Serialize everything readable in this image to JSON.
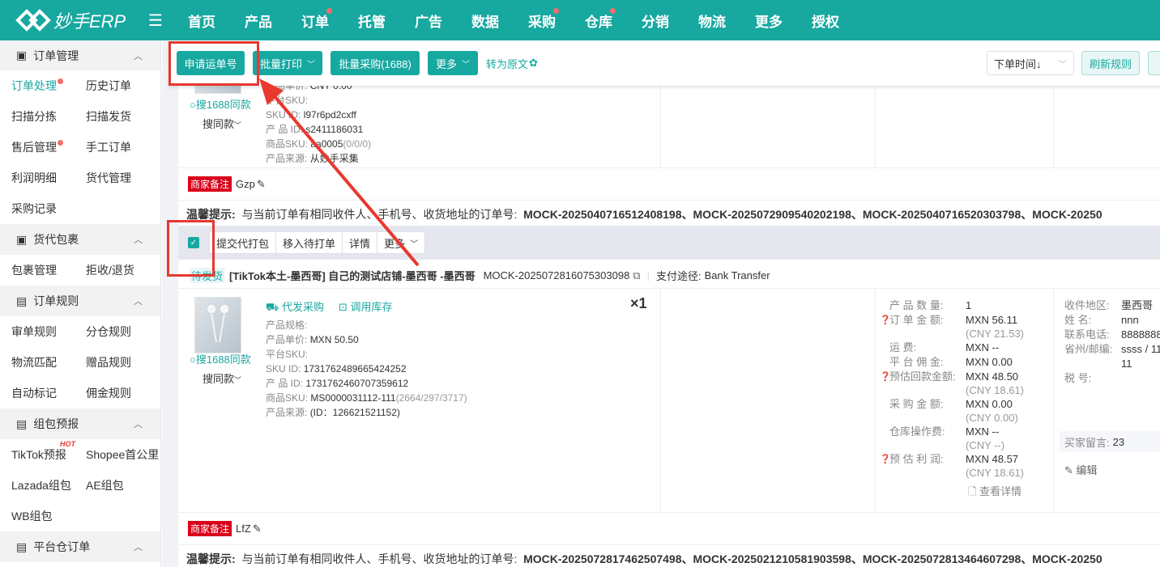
{
  "app": {
    "logo_text": "妙手ERP"
  },
  "nav": [
    {
      "label": "首页",
      "dot": false
    },
    {
      "label": "产品",
      "dot": false
    },
    {
      "label": "订单",
      "dot": true
    },
    {
      "label": "托管",
      "dot": false
    },
    {
      "label": "广告",
      "dot": false
    },
    {
      "label": "数据",
      "dot": false
    },
    {
      "label": "采购",
      "dot": true
    },
    {
      "label": "仓库",
      "dot": true
    },
    {
      "label": "分销",
      "dot": false
    },
    {
      "label": "物流",
      "dot": false
    },
    {
      "label": "更多",
      "dot": false
    },
    {
      "label": "授权",
      "dot": false
    }
  ],
  "sidebar": {
    "sections": [
      {
        "title": "订单管理",
        "items": [
          "订单处理",
          "历史订单",
          "扫描分拣",
          "扫描发货",
          "售后管理",
          "手工订单",
          "利润明细",
          "货代管理",
          "采购记录"
        ]
      },
      {
        "title": "货代包裹",
        "items": [
          "包裹管理",
          "拒收/退货"
        ]
      },
      {
        "title": "订单规则",
        "items": [
          "审单规则",
          "分仓规则",
          "物流匹配",
          "赠品规则",
          "自动标记",
          "佣金规则"
        ]
      },
      {
        "title": "组包预报",
        "items": [
          "TikTok预报",
          "Shopee首公里",
          "Lazada组包",
          "AE组包",
          "WB组包"
        ]
      },
      {
        "title": "平台仓订单",
        "items": []
      }
    ],
    "hot_label": "HOT"
  },
  "toolbar": {
    "apply_waybill": "申请运单号",
    "batch_print": "批量打印",
    "batch_purchase": "批量采购(1688)",
    "more": "更多",
    "to_original": "转为原文",
    "sort_select": "下单时间↓",
    "refresh_rules": "刷新规则"
  },
  "order1": {
    "partial_price": "CNY 0.00",
    "platform_sku_label": "平台SKU:",
    "sku_id_label": "SKU   ID:",
    "sku_id": "l97r6pd2cxff",
    "product_id_label": "产 品 ID:",
    "product_id": "s2411186031",
    "goods_sku_label": "商品SKU:",
    "goods_sku": "aa0005",
    "goods_sku_stock": "(0/0/0)",
    "source_label": "产品来源:",
    "source": "从妙手采集",
    "search1688": "搜1688同款",
    "search_same": "搜同款",
    "merchant_note_tag": "商家备注",
    "merchant_note": "Gzp",
    "tip_label": "温馨提示:",
    "tip_text": "与当前订单有相同收件人、手机号、收货地址的订单号:",
    "tip_orders": "MOCK-2025040716512408198、MOCK-2025072909540202198、MOCK-2025040716520303798、MOCK-20250"
  },
  "actions": {
    "submit_pack": "提交代打包",
    "move_pending": "移入待打单",
    "detail": "详情",
    "more": "更多"
  },
  "order2": {
    "status": "待发货",
    "shop": "[TikTok本土-墨西哥]  自己的测试店铺-墨西哥 -墨西哥",
    "order_no": "MOCK-2025072816075303098",
    "payment_label": "支付途径:",
    "payment": "Bank Transfer",
    "purchase_link": "代发采购",
    "inventory_link": "调用库存",
    "qty": "×1",
    "spec_label": "产品规格:",
    "unit_price_label": "产品单价:",
    "unit_price": "MXN 50.50",
    "platform_sku_label": "平台SKU:",
    "sku_id_label": "SKU   ID:",
    "sku_id": "1731762489665424252",
    "product_id_label": "产 品 ID:",
    "product_id": "1731762460707359612",
    "goods_sku_label": "商品SKU:",
    "goods_sku": "MS0000031112-111",
    "goods_sku_stock": "(2664/297/3717)",
    "source_label": "产品来源:",
    "source": "(ID：126621521152)",
    "search1688": "搜1688同款",
    "search_same": "搜同款",
    "amounts": [
      {
        "label": "产 品 数 量:",
        "value": "1",
        "sub": "",
        "help": false
      },
      {
        "label": "订 单 金 额:",
        "value": "MXN 56.11",
        "sub": "(CNY 21.53)",
        "help": true
      },
      {
        "label": "运       费:",
        "value": "MXN --",
        "sub": "",
        "help": false
      },
      {
        "label": "平 台 佣 金:",
        "value": "MXN 0.00",
        "sub": "",
        "help": false
      },
      {
        "label": "预估回款金额:",
        "value": "MXN 48.50",
        "sub": "(CNY 18.61)",
        "help": true
      },
      {
        "label": "采 购 金 额:",
        "value": "MXN 0.00",
        "sub": "(CNY 0.00)",
        "help": false
      },
      {
        "label": "仓库操作费:",
        "value": "MXN --",
        "sub": "(CNY --)",
        "help": false
      },
      {
        "label": "预 估 利 润:",
        "value": "MXN 48.57",
        "sub": "(CNY 18.61)",
        "help": true
      }
    ],
    "view_detail": "查看详情",
    "recipient": [
      {
        "label": "收件地区:",
        "value": "墨西哥"
      },
      {
        "label": "姓      名:",
        "value": "nnn"
      },
      {
        "label": "联系电话:",
        "value": "8888888"
      },
      {
        "label": "省州/邮编:",
        "value": "ssss / 11"
      },
      {
        "label": "",
        "value": "11"
      },
      {
        "label": "税      号:",
        "value": ""
      }
    ],
    "buyer_msg_label": "买家留言:",
    "buyer_msg": "23",
    "edit": "编辑",
    "merchant_note_tag": "商家备注",
    "merchant_note": "LfZ",
    "tip_label": "温馨提示:",
    "tip_text": "与当前订单有相同收件人、手机号、收货地址的订单号:",
    "tip_orders": "MOCK-2025072817462507498、MOCK-2025021210581903598、MOCK-2025072813464607298、MOCK-20250"
  },
  "colors": {
    "brand": "#17a8a0",
    "annotation_red": "#e8382f",
    "note_tag": "#d9001b",
    "dot_red": "#f56c6c"
  }
}
